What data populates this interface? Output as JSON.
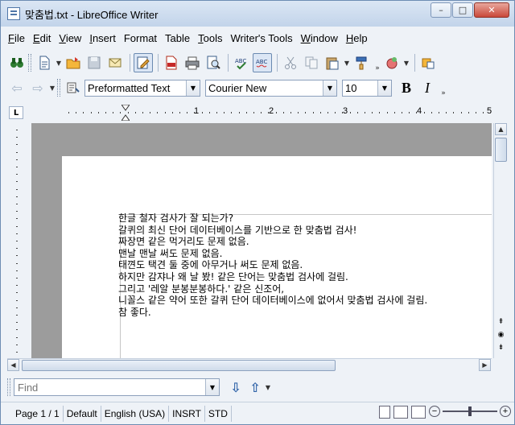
{
  "window": {
    "title": "맞춤법.txt - LibreOffice Writer",
    "controls": {
      "minimize": "–",
      "maximize": "□",
      "close": "✕"
    }
  },
  "menu": [
    {
      "label": "File",
      "accel": "F",
      "rest": "ile"
    },
    {
      "label": "Edit",
      "accel": "E",
      "rest": "dit"
    },
    {
      "label": "View",
      "accel": "V",
      "rest": "iew"
    },
    {
      "label": "Insert",
      "accel": "I",
      "rest": "nsert"
    },
    {
      "label": "Format",
      "accel": "",
      "rest": "Format"
    },
    {
      "label": "Table",
      "accel": "",
      "rest": "Table"
    },
    {
      "label": "Tools",
      "accel": "T",
      "rest": "ools"
    },
    {
      "label": "Writer's Tools",
      "accel": "",
      "rest": "Writer's Tools"
    },
    {
      "label": "Window",
      "accel": "W",
      "rest": "indow"
    },
    {
      "label": "Help",
      "accel": "H",
      "rest": "elp"
    }
  ],
  "toolbar": {
    "icons": [
      "find-binoculars-icon",
      "new-document-icon",
      "open-folder-icon",
      "save-icon",
      "email-icon",
      "edit-mode-icon",
      "export-pdf-icon",
      "print-icon",
      "print-preview-icon",
      "spellcheck-icon",
      "autospellcheck-icon",
      "cut-icon",
      "copy-icon",
      "paste-icon",
      "clone-formatting-icon",
      "gallery-icon",
      "navigator-icon"
    ]
  },
  "formatting": {
    "paragraph_style": "Preformatted Text",
    "font_name": "Courier New",
    "font_size": "10",
    "bold": "B",
    "italic": "I"
  },
  "ruler": {
    "numbers": [
      "1",
      "2",
      "3",
      "4",
      "5"
    ],
    "corner": "L"
  },
  "document": {
    "lines": [
      "한글 철자 검사가 잘 되는가?",
      "갈퀴의 최신 단어 데이터베이스를 기반으로 한 맞춤법 검사!",
      "짜장면 같은 먹거리도 문제 없음.",
      "맨날 맨날 써도 문제 없음.",
      "태껸도 택견 둘 중에 아무거나 써도 문제 없음.",
      "하지만 감쟈나 왜 날 봤! 같은 단어는 맞춤법 검사에 걸림.",
      "그리고 '레알 분봉분봉하다.' 같은 신조어,",
      "니꼴스 같은 약어 또한 갈퀴 단어 데이터베이스에 없어서 맞춤법 검사에 걸림.",
      "참 좋다."
    ],
    "faded_from_line": 6
  },
  "find": {
    "placeholder": "Find"
  },
  "status": {
    "page": "Page 1 / 1",
    "style": "Default",
    "language": "English (USA)",
    "insert_mode": "INSRT",
    "selection_mode": "STD"
  },
  "colors": {
    "accent": "#6d8cb3",
    "doc_background": "#9c9c9c",
    "close_button": "#c9483a"
  }
}
